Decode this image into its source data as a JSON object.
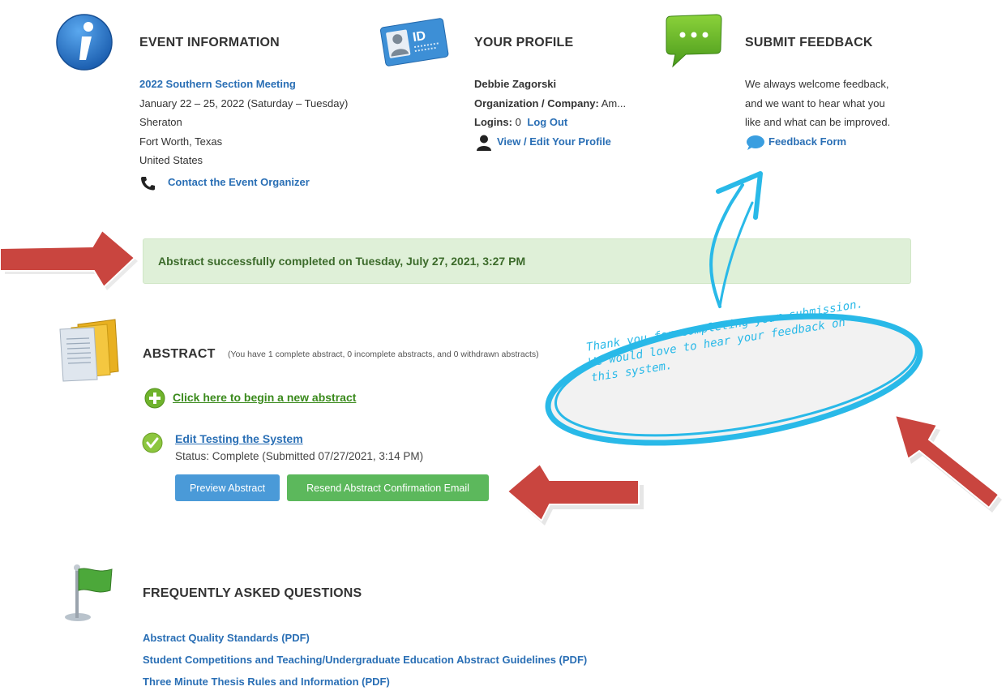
{
  "event": {
    "heading": "EVENT INFORMATION",
    "meeting_link": "2022 Southern Section Meeting",
    "dates": "January 22 – 25, 2022 (Saturday – Tuesday)",
    "venue": "Sheraton",
    "city": "Fort Worth, Texas",
    "country": "United States",
    "contact_link": "Contact the Event Organizer"
  },
  "profile": {
    "heading": "YOUR PROFILE",
    "badge_text": "ID",
    "name": "Debbie Zagorski",
    "org_label": "Organization / Company:",
    "org_value": "Am...",
    "logins_label": "Logins:",
    "logins_value": "0",
    "logout_link": "Log Out",
    "edit_link": "View / Edit Your Profile"
  },
  "feedback": {
    "heading": "SUBMIT FEEDBACK",
    "line1": "We always welcome feedback,",
    "line2": "and we want to hear what you",
    "line3": "like and what can be improved.",
    "form_link": "Feedback Form"
  },
  "alert": {
    "message": "Abstract successfully completed on Tuesday, July 27, 2021, 3:27 PM"
  },
  "abstract": {
    "heading": "ABSTRACT",
    "summary": "(You have 1 complete abstract, 0 incomplete abstracts, and 0 withdrawn abstracts)",
    "new_link": "Click here to begin a new abstract",
    "item_link": "Edit Testing the System",
    "status": "Status: Complete (Submitted 07/27/2021, 3:14 PM)",
    "preview_button": "Preview Abstract",
    "resend_button": "Resend Abstract Confirmation Email"
  },
  "callout": {
    "line1": "Thank you for completing your submission.",
    "line2": "We would love to hear your feedback on",
    "line3": "this system."
  },
  "faq": {
    "heading": "FREQUENTLY ASKED QUESTIONS",
    "links": [
      "Abstract Quality Standards (PDF)",
      "Student Competitions and Teaching/Undergraduate Education Abstract Guidelines (PDF)",
      "Three Minute Thesis Rules and Information (PDF)"
    ]
  },
  "colors": {
    "link": "#2a6fb5",
    "alert_bg": "#dff0d8",
    "annotation_arrow": "#c9453f",
    "callout": "#29b9e8",
    "button_blue": "#4a9ad8",
    "button_green": "#5cb85c"
  },
  "icons": [
    "info-icon",
    "id-card-icon",
    "speech-bubble-icon",
    "phone-icon",
    "person-icon",
    "chat-icon",
    "folder-icon",
    "plus-circle-icon",
    "checkmark-icon",
    "flag-icon",
    "annotation-arrow-icon"
  ]
}
